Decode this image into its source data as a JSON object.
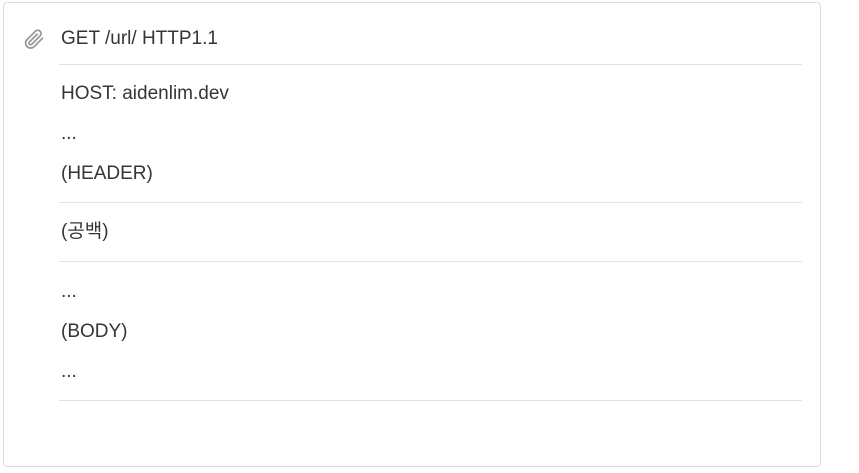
{
  "attachment": {
    "icon": "paperclip-icon",
    "lines": [
      "GET /url/ HTTP1.1",
      "HOST: aidenlim.dev",
      "...",
      "(HEADER)",
      "(공백)",
      "...",
      "(BODY)",
      "..."
    ]
  }
}
